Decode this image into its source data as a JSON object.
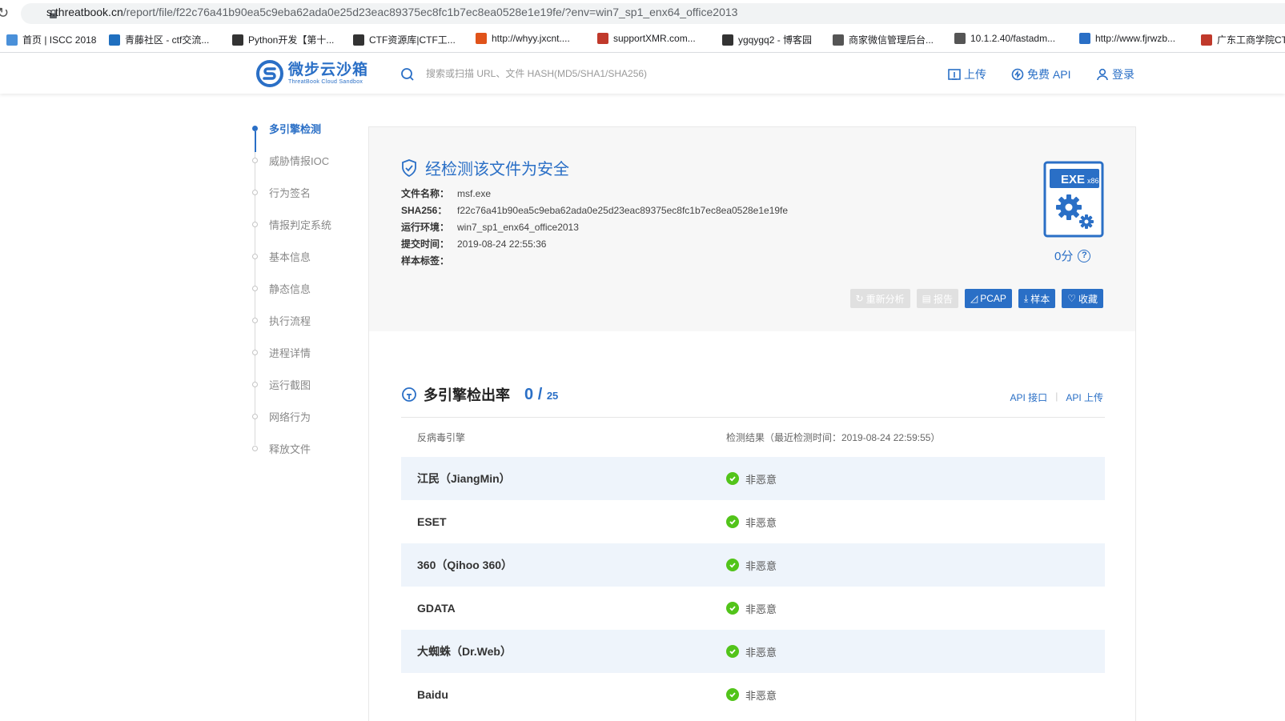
{
  "browser": {
    "url_host": "s.threatbook.cn",
    "url_path": "/report/file/f22c76a41b90ea5c9eba62ada0e25d23eac89375ec8fc1b7ec8ea0528e1e19fe/?env=win7_sp1_enx64_office2013"
  },
  "bookmarks": [
    {
      "label": "首页 | ISCC 2018",
      "icon": "globe-icon",
      "color": "#4a90d9"
    },
    {
      "label": "青藤社区 - ctf交流...",
      "icon": "t-icon",
      "color": "#1f6fbf"
    },
    {
      "label": "Python开发【第十...",
      "icon": "feather-icon",
      "color": "#333333"
    },
    {
      "label": "CTF资源库|CTF工...",
      "icon": "person-icon",
      "color": "#333333"
    },
    {
      "label": "http://whyy.jxcnt....",
      "icon": "flag-icon",
      "color": "#e0531a"
    },
    {
      "label": "supportXMR.com...",
      "icon": "flag-icon",
      "color": "#c0392b"
    },
    {
      "label": "ygqygq2 - 博客园",
      "icon": "feather-icon",
      "color": "#333333"
    },
    {
      "label": "商家微信管理后台...",
      "icon": "globe-icon",
      "color": "#555555"
    },
    {
      "label": "10.1.2.40/fastadm...",
      "icon": "globe-icon",
      "color": "#555555"
    },
    {
      "label": "http://www.fjrwzb...",
      "icon": "grid-icon",
      "color": "#2a6fc6"
    },
    {
      "label": "广东工商学院CT",
      "icon": "pin-icon",
      "color": "#c0392b"
    }
  ],
  "header": {
    "logo_cn": "微步云沙箱",
    "logo_en": "ThreatBook Cloud Sandbox",
    "search_placeholder": "搜索或扫描 URL、文件 HASH(MD5/SHA1/SHA256)",
    "upload": "上传",
    "free_api": "免费 API",
    "login": "登录"
  },
  "nav": [
    {
      "label": "多引擎检测",
      "active": true
    },
    {
      "label": "威胁情报IOC"
    },
    {
      "label": "行为签名"
    },
    {
      "label": "情报判定系统"
    },
    {
      "label": "基本信息"
    },
    {
      "label": "静态信息"
    },
    {
      "label": "执行流程"
    },
    {
      "label": "进程详情"
    },
    {
      "label": "运行截图"
    },
    {
      "label": "网络行为"
    },
    {
      "label": "释放文件"
    }
  ],
  "summary": {
    "verdict": "经检测该文件为安全",
    "fields": [
      {
        "key": "文件名称：",
        "value": "msf.exe"
      },
      {
        "key": "SHA256：",
        "value": "f22c76a41b90ea5c9eba62ada0e25d23eac89375ec8fc1b7ec8ea0528e1e19fe"
      },
      {
        "key": "运行环境：",
        "value": "win7_sp1_enx64_office2013"
      },
      {
        "key": "提交时间：",
        "value": "2019-08-24 22:55:36"
      },
      {
        "key": "样本标签：",
        "value": ""
      }
    ],
    "file_type": "EXE",
    "arch": "x86",
    "score": "0分",
    "buttons": {
      "reanalyze": "重新分析",
      "report": "报告",
      "pcap": "PCAP",
      "sample": "样本",
      "favorite": "收藏"
    }
  },
  "detection": {
    "title": "多引擎检出率",
    "detected": "0",
    "slash": "/",
    "total": "25",
    "api_interface": "API 接口",
    "api_upload": "API 上传",
    "col_engine": "反病毒引擎",
    "col_result": "检测结果（最近检测时间：2019-08-24 22:59:55）",
    "rows": [
      {
        "engine": "江民（JiangMin）",
        "result": "非恶意"
      },
      {
        "engine": "ESET",
        "result": "非恶意"
      },
      {
        "engine": "360（Qihoo 360）",
        "result": "非恶意"
      },
      {
        "engine": "GDATA",
        "result": "非恶意"
      },
      {
        "engine": "大蜘蛛（Dr.Web）",
        "result": "非恶意"
      },
      {
        "engine": "Baidu",
        "result": "非恶意"
      }
    ]
  },
  "colors": {
    "accent": "#2a6fc6",
    "ok": "#52c41a"
  }
}
